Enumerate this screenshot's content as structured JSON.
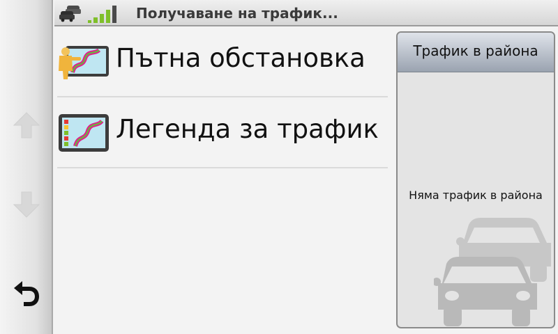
{
  "header": {
    "title": "Получаване на трафик...",
    "icons": {
      "traffic": "traffic-cars-icon",
      "signal": "signal-strength-icon"
    },
    "signal_level": 4
  },
  "nav": {
    "up": "arrow-up-icon",
    "down": "arrow-down-icon",
    "back": "back-icon"
  },
  "menu": {
    "items": [
      {
        "label": "Пътна обстановка",
        "icon": "road-conditions-icon"
      },
      {
        "label": "Легенда за трафик",
        "icon": "traffic-legend-icon"
      }
    ]
  },
  "panel": {
    "title": "Трафик в района",
    "message": "Няма трафик в района",
    "icon": "traffic-cars-watermark-icon"
  },
  "colors": {
    "signal_green": "#7fbf2a",
    "route_magenta": "#e0218a",
    "route_green": "#5ec23a"
  }
}
